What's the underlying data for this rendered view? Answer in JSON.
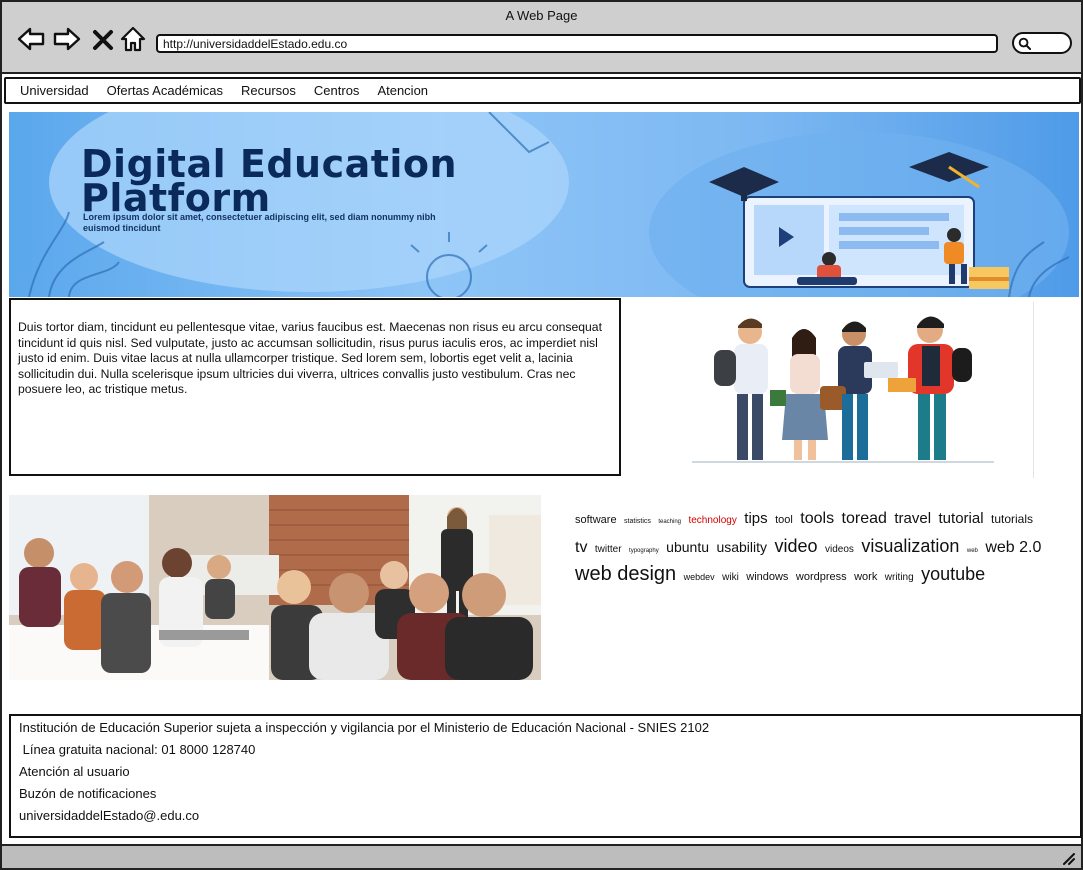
{
  "window": {
    "title": "A Web Page"
  },
  "browser": {
    "url": "http://universidaddelEstado.edu.co",
    "icons": [
      "back-arrow-icon",
      "forward-arrow-icon",
      "close-x-icon",
      "home-icon",
      "search-icon"
    ]
  },
  "menu": {
    "items": [
      "Universidad",
      "Ofertas Académicas",
      "Recursos",
      "Centros",
      "Atencion"
    ]
  },
  "hero": {
    "title_line1": "Digital Education",
    "title_line2": "Platform",
    "subtitle": "Lorem ipsum dolor sit amet, consectetuer adipiscing elit, sed diam nonummy nibh euismod tincidunt"
  },
  "main": {
    "paragraph": "Duis tortor diam, tincidunt eu pellentesque vitae, varius faucibus est. Maecenas non risus eu arcu consequat tincidunt id quis nisl. Sed vulputate, justo ac accumsan sollicitudin, risus purus iaculis eros, ac imperdiet nisl justo id enim. Duis vitae lacus at nulla ullamcorper tristique. Sed lorem sem, lobortis eget velit a, lacinia sollicitudin dui. Nulla scelerisque ipsum ultricies dui viverra, ultrices convallis justo vestibulum. Cras nec posuere leo, ac tristique metus."
  },
  "tagcloud": {
    "tags": [
      {
        "text": "software",
        "size": 11
      },
      {
        "text": "statistics",
        "size": 7
      },
      {
        "text": "teaching",
        "size": 6
      },
      {
        "text": "technology",
        "size": 10,
        "color": "#d40000"
      },
      {
        "text": "tips",
        "size": 15
      },
      {
        "text": "tool",
        "size": 11
      },
      {
        "text": "tools",
        "size": 16
      },
      {
        "text": "toread",
        "size": 16
      },
      {
        "text": "travel",
        "size": 15
      },
      {
        "text": "tutorial",
        "size": 15
      },
      {
        "text": "tutorials",
        "size": 12
      },
      {
        "text": "tv",
        "size": 16
      },
      {
        "text": "twitter",
        "size": 10
      },
      {
        "text": "typography",
        "size": 6
      },
      {
        "text": "ubuntu",
        "size": 14
      },
      {
        "text": "usability",
        "size": 14
      },
      {
        "text": "video",
        "size": 18
      },
      {
        "text": "videos",
        "size": 10
      },
      {
        "text": "visualization",
        "size": 18
      },
      {
        "text": "web",
        "size": 6
      },
      {
        "text": "web 2.0",
        "size": 16
      },
      {
        "text": "web design",
        "size": 20
      },
      {
        "text": "webdev",
        "size": 9
      },
      {
        "text": "wiki",
        "size": 10
      },
      {
        "text": "windows",
        "size": 11
      },
      {
        "text": "wordpress",
        "size": 11
      },
      {
        "text": "work",
        "size": 11
      },
      {
        "text": "writing",
        "size": 10
      },
      {
        "text": "youtube",
        "size": 18
      }
    ]
  },
  "footer": {
    "line1": "Institución de Educación Superior sujeta a inspección y vigilancia por el Ministerio de Educación Nacional - SNIES 2102",
    "line2": " Línea gratuita nacional: 01 8000 128740",
    "line3": "Atención al usuario",
    "line4": "Buzón de notificaciones",
    "line5": "universidaddelEstado@.edu.co"
  }
}
